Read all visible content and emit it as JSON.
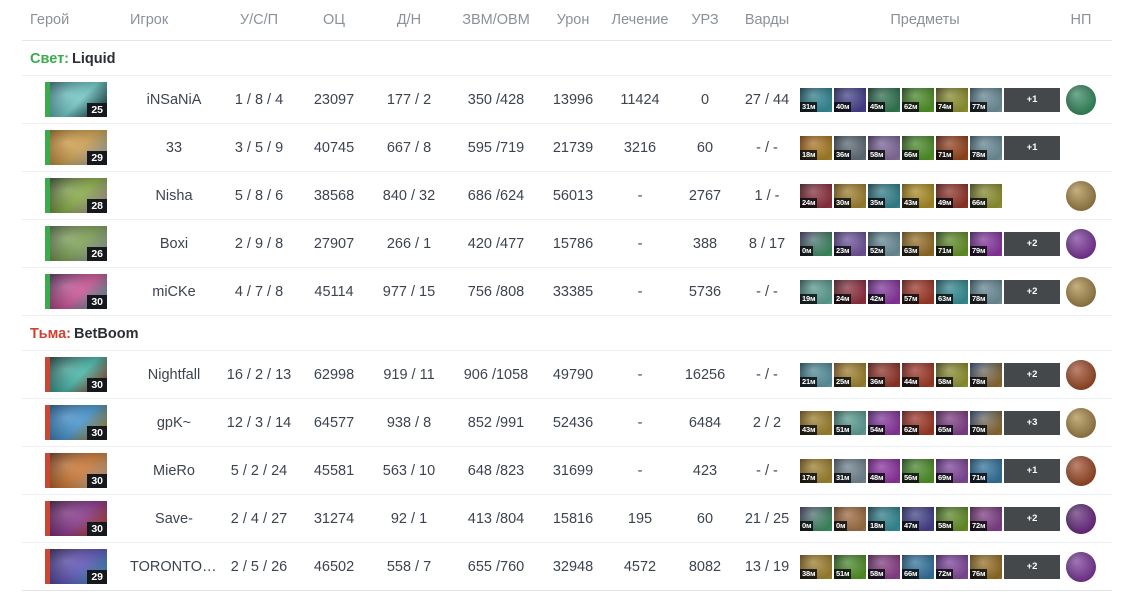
{
  "table": {
    "columns": [
      {
        "key": "hero",
        "label": "Герой"
      },
      {
        "key": "player",
        "label": "Игрок"
      },
      {
        "key": "kda",
        "label": "У/С/П"
      },
      {
        "key": "oc",
        "label": "ОЦ"
      },
      {
        "key": "dn",
        "label": "Д/Н"
      },
      {
        "key": "gxp",
        "label": "ЗВМ/ОВМ"
      },
      {
        "key": "damage",
        "label": "Урон"
      },
      {
        "key": "heal",
        "label": "Лечение"
      },
      {
        "key": "urz",
        "label": "УРЗ"
      },
      {
        "key": "wards",
        "label": "Варды"
      },
      {
        "key": "items",
        "label": "Предметы"
      },
      {
        "key": "np",
        "label": "НП"
      }
    ]
  },
  "teams": [
    {
      "side_label": "Свет:",
      "side": "radiant",
      "name": "Liquid",
      "accent": "#3aab4a",
      "players": [
        {
          "player": "iNSaNiA",
          "level": "25",
          "hero_colors": [
            "#2c5a66",
            "#7fe3e0",
            "#17313b"
          ],
          "kda": "1 / 8 / 4",
          "oc": "23097",
          "dn": "177 / 2",
          "gxp": "350 /428",
          "damage": "13996",
          "heal": "11424",
          "urz": "0",
          "wards": "27 / 44",
          "items": [
            {
              "time": "31м",
              "colors": [
                "#0e3d4a",
                "#4fd6e6"
              ]
            },
            {
              "time": "40м",
              "colors": [
                "#1d2358",
                "#6a5fd0"
              ]
            },
            {
              "time": "45м",
              "colors": [
                "#123528",
                "#49b97a"
              ]
            },
            {
              "time": "62м",
              "colors": [
                "#1d4a13",
                "#7ddc3b"
              ]
            },
            {
              "time": "74м",
              "colors": [
                "#4a4a10",
                "#d9e04a"
              ]
            },
            {
              "time": "77м",
              "colors": [
                "#2d4b57",
                "#a9d8e6"
              ]
            }
          ],
          "extra_items": "+1",
          "neutral_colors": [
            "#12503a",
            "#4fdc8e"
          ]
        },
        {
          "player": "33",
          "level": "29",
          "hero_colors": [
            "#8a5a18",
            "#e8b457",
            "#c9dbe8"
          ],
          "kda": "3 / 5 / 9",
          "oc": "40745",
          "dn": "667 / 8",
          "gxp": "595 /719",
          "damage": "21739",
          "heal": "3216",
          "urz": "60",
          "wards": "- / -",
          "items": [
            {
              "time": "18м",
              "colors": [
                "#7a3a06",
                "#f2c23a"
              ]
            },
            {
              "time": "36м",
              "colors": [
                "#2a3540",
                "#93a6b5"
              ]
            },
            {
              "time": "58м",
              "colors": [
                "#3b2a58",
                "#c9a8e8"
              ]
            },
            {
              "time": "66м",
              "colors": [
                "#1d4a13",
                "#7ddc3b"
              ]
            },
            {
              "time": "71м",
              "colors": [
                "#5a1c0c",
                "#e06a2a"
              ]
            },
            {
              "time": "78м",
              "colors": [
                "#2d4b57",
                "#a9d8e6"
              ]
            }
          ],
          "extra_items": "+1",
          "neutral_colors": null
        },
        {
          "player": "Nisha",
          "level": "28",
          "hero_colors": [
            "#2e3a2a",
            "#9ac44f",
            "#e8b9d8"
          ],
          "kda": "5 / 8 / 6",
          "oc": "38568",
          "dn": "840 / 32",
          "gxp": "686 /624",
          "damage": "56013",
          "heal": "-",
          "urz": "2767",
          "wards": "1 / -",
          "items": [
            {
              "time": "24м",
              "colors": [
                "#4a1420",
                "#d8485e"
              ]
            },
            {
              "time": "30м",
              "colors": [
                "#6b4a0c",
                "#e8c34a"
              ]
            },
            {
              "time": "35м",
              "colors": [
                "#13434c",
                "#4fc7d8"
              ]
            },
            {
              "time": "43м",
              "colors": [
                "#7a5a06",
                "#f2ce3a"
              ]
            },
            {
              "time": "49м",
              "colors": [
                "#5a1410",
                "#d8503a"
              ]
            },
            {
              "time": "66м",
              "colors": [
                "#4a4a10",
                "#d9e04a"
              ]
            }
          ],
          "extra_items": null,
          "neutral_colors": [
            "#8a6a22",
            "#e8c070"
          ]
        },
        {
          "player": "Boxi",
          "level": "26",
          "hero_colors": [
            "#49583f",
            "#8fb860",
            "#c3cdd4"
          ],
          "kda": "2 / 9 / 8",
          "oc": "27907",
          "dn": "266 / 1",
          "gxp": "420 /477",
          "damage": "15786",
          "heal": "-",
          "urz": "388",
          "wards": "8 / 17",
          "items": [
            {
              "time": "0м",
              "colors": [
                "#3a2a58",
                "#55d888"
              ]
            },
            {
              "time": "23м",
              "colors": [
                "#3b2a68",
                "#a87fe0"
              ]
            },
            {
              "time": "52м",
              "colors": [
                "#2d4b57",
                "#a9d8e6"
              ]
            },
            {
              "time": "63м",
              "colors": [
                "#6a4a10",
                "#d8a03a"
              ]
            },
            {
              "time": "71м",
              "colors": [
                "#2a4a10",
                "#9ddc3b"
              ]
            },
            {
              "time": "79м",
              "colors": [
                "#4a1a68",
                "#d04fe8"
              ]
            }
          ],
          "extra_items": "+2",
          "neutral_colors": [
            "#4a1a6a",
            "#c050e8"
          ]
        },
        {
          "player": "miCKe",
          "level": "30",
          "hero_colors": [
            "#3a2248",
            "#e85fa8",
            "#5fd8d0"
          ],
          "kda": "4 / 7 / 8",
          "oc": "45114",
          "dn": "977 / 15",
          "gxp": "756 /808",
          "damage": "33385",
          "heal": "-",
          "urz": "5736",
          "wards": "- / -",
          "items": [
            {
              "time": "19м",
              "colors": [
                "#2a5a52",
                "#8ff0e0"
              ]
            },
            {
              "time": "24м",
              "colors": [
                "#4a1420",
                "#d8485e"
              ]
            },
            {
              "time": "42м",
              "colors": [
                "#4a1a68",
                "#d04fe8"
              ]
            },
            {
              "time": "57м",
              "colors": [
                "#6a1410",
                "#e8583a"
              ]
            },
            {
              "time": "63м",
              "colors": [
                "#134a52",
                "#4fd8e0"
              ]
            },
            {
              "time": "78м",
              "colors": [
                "#2d4b57",
                "#a9d8e6"
              ]
            }
          ],
          "extra_items": "+2",
          "neutral_colors": [
            "#8a6a22",
            "#e8c070"
          ]
        }
      ]
    },
    {
      "side_label": "Тьма:",
      "side": "dire",
      "name": "BetBoom",
      "accent": "#d0412e",
      "players": [
        {
          "player": "Nightfall",
          "level": "30",
          "hero_colors": [
            "#17302c",
            "#4fd0c0",
            "#d84a2a"
          ],
          "kda": "16 / 2 / 13",
          "oc": "62998",
          "dn": "919 / 11",
          "gxp": "906 /1058",
          "damage": "49790",
          "heal": "-",
          "urz": "16256",
          "wards": "- / -",
          "items": [
            {
              "time": "21м",
              "colors": [
                "#1d4a5a",
                "#8fe0f0"
              ]
            },
            {
              "time": "25м",
              "colors": [
                "#6b4a0c",
                "#e8c34a"
              ]
            },
            {
              "time": "36м",
              "colors": [
                "#5a1410",
                "#d8503a"
              ]
            },
            {
              "time": "44м",
              "colors": [
                "#6a1410",
                "#e8583a"
              ]
            },
            {
              "time": "58м",
              "colors": [
                "#4a4a10",
                "#d9e04a"
              ]
            },
            {
              "time": "78м",
              "colors": [
                "#1d3a6a",
                "#d8a03a"
              ]
            }
          ],
          "extra_items": "+2",
          "neutral_colors": [
            "#7a2a10",
            "#e8703a"
          ]
        },
        {
          "player": "gpK~",
          "level": "30",
          "hero_colors": [
            "#1a4a7a",
            "#4fa8e8",
            "#e8b020"
          ],
          "kda": "12 / 3 / 14",
          "oc": "64577",
          "dn": "938 / 8",
          "gxp": "852 /991",
          "damage": "52436",
          "heal": "-",
          "urz": "6484",
          "wards": "2 / 2",
          "items": [
            {
              "time": "43м",
              "colors": [
                "#6b4a0c",
                "#e8c34a"
              ]
            },
            {
              "time": "51м",
              "colors": [
                "#2a5a52",
                "#8ff0e0"
              ]
            },
            {
              "time": "54м",
              "colors": [
                "#4a1a68",
                "#d04fe8"
              ]
            },
            {
              "time": "62м",
              "colors": [
                "#6a1410",
                "#e8583a"
              ]
            },
            {
              "time": "65м",
              "colors": [
                "#4a1a48",
                "#c05fd0"
              ]
            },
            {
              "time": "70м",
              "colors": [
                "#1d3a6a",
                "#d8a03a"
              ]
            }
          ],
          "extra_items": "+3",
          "neutral_colors": [
            "#8a6a22",
            "#e8c070"
          ]
        },
        {
          "player": "MieRo",
          "level": "30",
          "hero_colors": [
            "#5a2a12",
            "#e8893a",
            "#f0e0d0"
          ],
          "kda": "5 / 2 / 24",
          "oc": "45581",
          "dn": "563 / 10",
          "gxp": "648 /823",
          "damage": "31699",
          "heal": "-",
          "urz": "423",
          "wards": "- / -",
          "items": [
            {
              "time": "17м",
              "colors": [
                "#6b4a0c",
                "#e8c34a"
              ]
            },
            {
              "time": "31м",
              "colors": [
                "#3a4a55",
                "#b0c8d8"
              ]
            },
            {
              "time": "48м",
              "colors": [
                "#5a1070",
                "#d04fe8"
              ]
            },
            {
              "time": "56м",
              "colors": [
                "#1d4a13",
                "#7ddc3b"
              ]
            },
            {
              "time": "69м",
              "colors": [
                "#4a1a68",
                "#c06fe0"
              ]
            },
            {
              "time": "71м",
              "colors": [
                "#134a6a",
                "#4fa8e8"
              ]
            }
          ],
          "extra_items": "+1",
          "neutral_colors": [
            "#7a2a10",
            "#e8703a"
          ]
        },
        {
          "player": "Save-",
          "level": "30",
          "hero_colors": [
            "#3a1038",
            "#9a3fa0",
            "#e85a2a"
          ],
          "kda": "2 / 4 / 27",
          "oc": "31274",
          "dn": "92 / 1",
          "gxp": "413 /804",
          "damage": "15816",
          "heal": "195",
          "urz": "60",
          "wards": "21 / 25",
          "items": [
            {
              "time": "0м",
              "colors": [
                "#3a2a58",
                "#55d888"
              ]
            },
            {
              "time": "0м",
              "colors": [
                "#6a3a18",
                "#e8a868"
              ]
            },
            {
              "time": "18м",
              "colors": [
                "#0e3d4a",
                "#4fd6e6"
              ]
            },
            {
              "time": "47м",
              "colors": [
                "#1d2358",
                "#6a5fd0"
              ]
            },
            {
              "time": "58м",
              "colors": [
                "#2a4a10",
                "#9ddc3b"
              ]
            },
            {
              "time": "72м",
              "colors": [
                "#4a1a48",
                "#c05fd0"
              ]
            }
          ],
          "extra_items": "+2",
          "neutral_colors": [
            "#2a0a3a",
            "#b040d8"
          ]
        },
        {
          "player": "TORONTOT…",
          "level": "29",
          "hero_colors": [
            "#2a1a4a",
            "#6a5fd0",
            "#4fc8e8"
          ],
          "kda": "2 / 5 / 26",
          "oc": "46502",
          "dn": "558 / 7",
          "gxp": "655 /760",
          "damage": "32948",
          "heal": "4572",
          "urz": "8082",
          "wards": "13 / 19",
          "items": [
            {
              "time": "38м",
              "colors": [
                "#6b4a0c",
                "#e8c34a"
              ]
            },
            {
              "time": "51м",
              "colors": [
                "#1d4a13",
                "#7ddc3b"
              ]
            },
            {
              "time": "58м",
              "colors": [
                "#4a1a48",
                "#d05fd0"
              ]
            },
            {
              "time": "66м",
              "colors": [
                "#134a6a",
                "#4fa8e8"
              ]
            },
            {
              "time": "72м",
              "colors": [
                "#4a1a68",
                "#c06fe0"
              ]
            },
            {
              "time": "76м",
              "colors": [
                "#6a4a10",
                "#d8a03a"
              ]
            }
          ],
          "extra_items": "+2",
          "neutral_colors": [
            "#4a1a6a",
            "#c050e8"
          ]
        }
      ]
    }
  ]
}
